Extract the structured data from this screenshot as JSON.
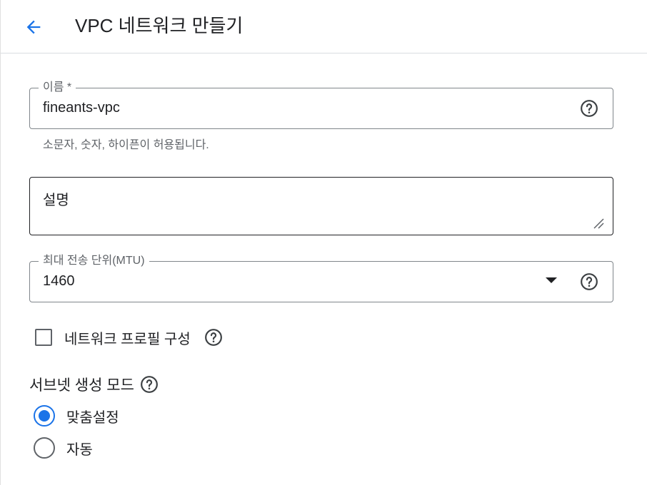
{
  "header": {
    "title": "VPC 네트워크 만들기",
    "back_icon": "arrow-back-icon",
    "accent_color": "#1a73e8"
  },
  "name_field": {
    "label": "이름 *",
    "value": "fineants-vpc",
    "hint": "소문자, 숫자, 하이픈이 허용됩니다.",
    "help_icon": "help-circle-icon"
  },
  "description_field": {
    "placeholder": "설명",
    "value": ""
  },
  "mtu_field": {
    "label": "최대 전송 단위(MTU)",
    "selected": "1460",
    "help_icon": "help-circle-icon"
  },
  "network_profile": {
    "label": "네트워크 프로필 구성",
    "checked": false
  },
  "subnet_mode": {
    "title": "서브넷 생성 모드",
    "options": [
      {
        "label": "맞춤설정",
        "checked": true
      },
      {
        "label": "자동",
        "checked": false
      }
    ]
  }
}
